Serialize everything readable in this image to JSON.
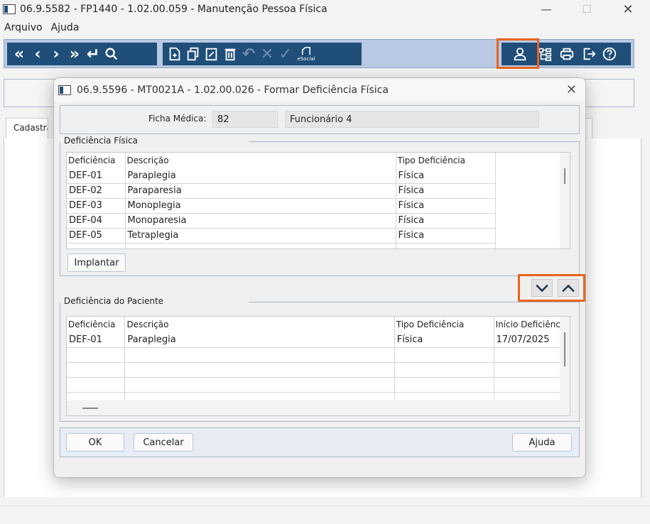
{
  "main_window": {
    "title": "06.9.5582 - FP1440 - 1.02.00.059 - Manutenção Pessoa Física",
    "minimize": "—",
    "maximize": "☐",
    "close": "✕"
  },
  "menu": [
    "Arquivo",
    "Ajuda"
  ],
  "toolbar": {
    "nav_icons": [
      "first-icon",
      "prev-icon",
      "next-icon",
      "last-icon",
      "return-icon",
      "search-icon"
    ],
    "action_icons": [
      "new-icon",
      "copy-icon",
      "edit-icon",
      "delete-icon",
      "undo-icon",
      "cancel-icon",
      "confirm-icon"
    ],
    "esocial_label": "eSocial",
    "right_icons": [
      "user-icon",
      "tree-icon",
      "print-icon",
      "exit-icon",
      "help-icon"
    ],
    "highlight_color": "#e8641c",
    "bar_color": "#1f4e79"
  },
  "main_tab": "Cadastral",
  "dialog": {
    "title": "06.9.5596 - MT0021A - 1.02.00.026 - Formar Deficiência Física",
    "close": "✕",
    "ficha_label": "Ficha Médica:",
    "ficha_value": "82",
    "funcionario": "Funcionário 4",
    "def_fisica": {
      "legend": "Deficiência Física",
      "columns": [
        "Deficiência",
        "Descrição",
        "Tipo Deficiência"
      ],
      "rows": [
        [
          "DEF-01",
          "Paraplegia",
          "Física"
        ],
        [
          "DEF-02",
          "Paraparesia",
          "Física"
        ],
        [
          "DEF-03",
          "Monoplegia",
          "Física"
        ],
        [
          "DEF-04",
          "Monoparesia",
          "Física"
        ],
        [
          "DEF-05",
          "Tetraplegia",
          "Física"
        ]
      ],
      "implantar": "Implantar"
    },
    "def_paciente": {
      "legend": "Deficiência do Paciente",
      "columns": [
        "Deficiência",
        "Descrição",
        "Tipo Deficiência",
        "Início Deficiência"
      ],
      "rows": [
        [
          "DEF-01",
          "Paraplegia",
          "Física",
          "17/07/2025"
        ]
      ]
    },
    "buttons": {
      "ok": "OK",
      "cancelar": "Cancelar",
      "ajuda": "Ajuda"
    }
  }
}
